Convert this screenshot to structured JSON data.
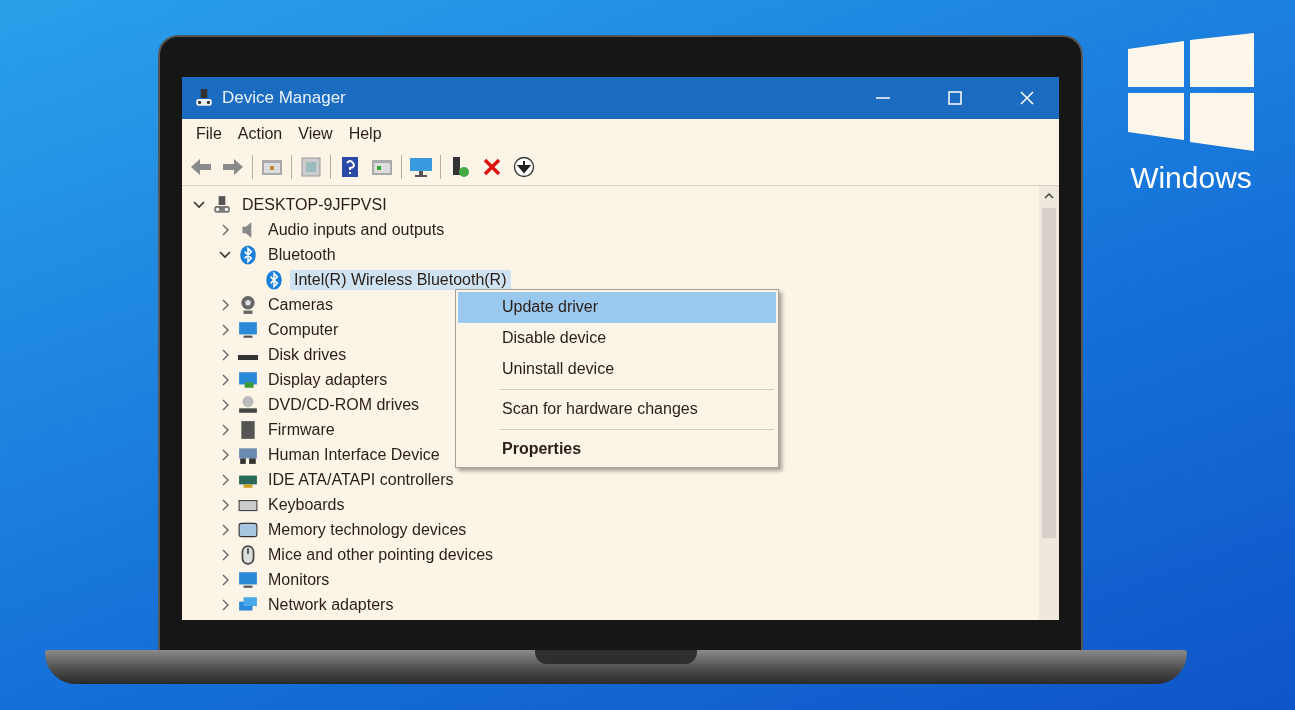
{
  "window": {
    "title": "Device Manager"
  },
  "menu": [
    "File",
    "Action",
    "View",
    "Help"
  ],
  "tree": {
    "label": "DESKTOP-9JFPVSI",
    "kind": "computer",
    "expanded": true,
    "selected": false,
    "children": [
      {
        "label": "Audio inputs and outputs",
        "kind": "speaker",
        "expanded": false,
        "selected": false
      },
      {
        "label": "Bluetooth",
        "kind": "bluetooth",
        "expanded": true,
        "selected": false,
        "children": [
          {
            "label": "Intel(R) Wireless Bluetooth(R)",
            "kind": "bluetooth",
            "selected": true
          }
        ]
      },
      {
        "label": "Cameras",
        "kind": "camera",
        "expanded": false,
        "selected": false
      },
      {
        "label": "Computer",
        "kind": "monitor",
        "expanded": false,
        "selected": false
      },
      {
        "label": "Disk drives",
        "kind": "disk",
        "expanded": false,
        "selected": false
      },
      {
        "label": "Display adapters",
        "kind": "display",
        "expanded": false,
        "selected": false
      },
      {
        "label": "DVD/CD-ROM drives",
        "kind": "dvd",
        "expanded": false,
        "selected": false
      },
      {
        "label": "Firmware",
        "kind": "chip",
        "expanded": false,
        "selected": false
      },
      {
        "label": "Human Interface Device",
        "kind": "hid",
        "expanded": false,
        "selected": false
      },
      {
        "label": "IDE ATA/ATAPI controllers",
        "kind": "ide",
        "expanded": false,
        "selected": false
      },
      {
        "label": "Keyboards",
        "kind": "keyboard",
        "expanded": false,
        "selected": false
      },
      {
        "label": "Memory technology devices",
        "kind": "memory",
        "expanded": false,
        "selected": false
      },
      {
        "label": "Mice and other pointing devices",
        "kind": "mouse",
        "expanded": false,
        "selected": false
      },
      {
        "label": "Monitors",
        "kind": "monitor",
        "expanded": false,
        "selected": false
      },
      {
        "label": "Network adapters",
        "kind": "network",
        "expanded": false,
        "selected": false
      }
    ]
  },
  "context_menu": [
    {
      "kind": "item",
      "label": "Update driver",
      "selected": true,
      "default": false
    },
    {
      "kind": "item",
      "label": "Disable device",
      "selected": false,
      "default": false
    },
    {
      "kind": "item",
      "label": "Uninstall device",
      "selected": false,
      "default": false
    },
    {
      "kind": "separator"
    },
    {
      "kind": "item",
      "label": "Scan for hardware changes",
      "selected": false,
      "default": false
    },
    {
      "kind": "separator"
    },
    {
      "kind": "item",
      "label": "Properties",
      "selected": false,
      "default": true
    }
  ],
  "logo": {
    "text": "Windows"
  }
}
